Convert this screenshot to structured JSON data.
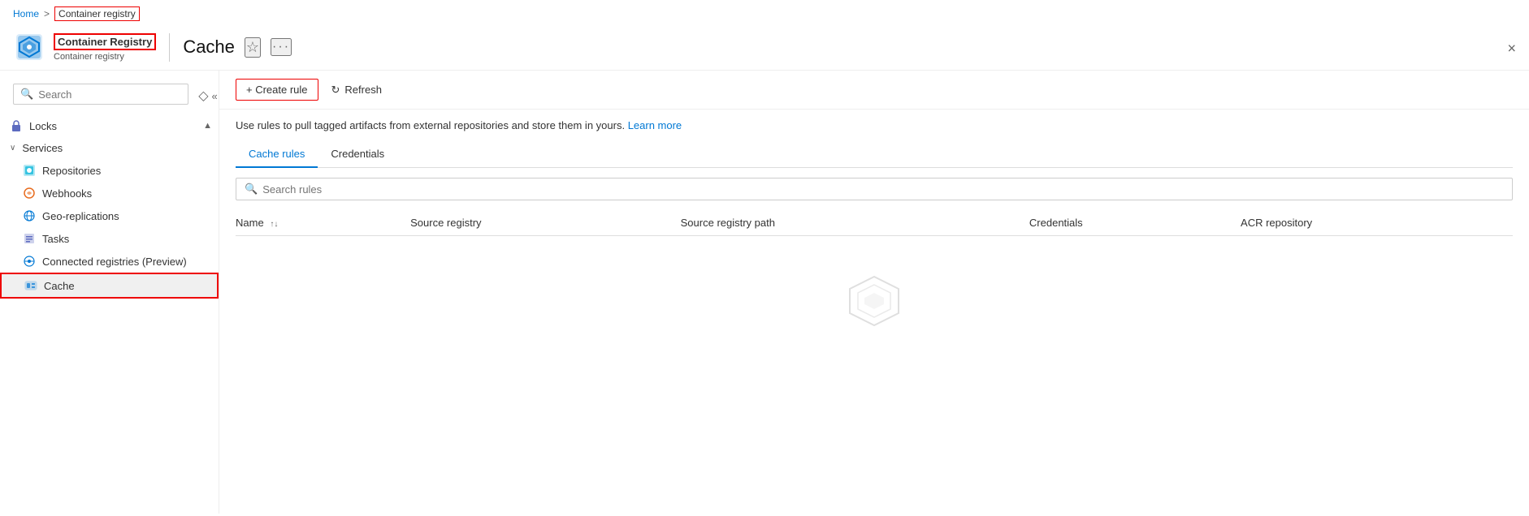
{
  "breadcrumb": {
    "home": "Home",
    "separator": ">",
    "current": "Container registry"
  },
  "header": {
    "service_name": "Container Registry",
    "sub_label": "Container registry",
    "resource_name": "Cache",
    "close_label": "×"
  },
  "sidebar": {
    "search_placeholder": "Search",
    "items_before": [
      {
        "id": "locks",
        "label": "Locks",
        "icon": "lock"
      }
    ],
    "services_group": "Services",
    "services_expanded": true,
    "service_items": [
      {
        "id": "repositories",
        "label": "Repositories",
        "icon": "repo"
      },
      {
        "id": "webhooks",
        "label": "Webhooks",
        "icon": "webhook"
      },
      {
        "id": "geo-replications",
        "label": "Geo-replications",
        "icon": "geo"
      },
      {
        "id": "tasks",
        "label": "Tasks",
        "icon": "task"
      },
      {
        "id": "connected-registries",
        "label": "Connected registries (Preview)",
        "icon": "connected"
      },
      {
        "id": "cache",
        "label": "Cache",
        "icon": "cache",
        "active": true
      }
    ]
  },
  "toolbar": {
    "create_rule_label": "+ Create rule",
    "refresh_label": "Refresh"
  },
  "content": {
    "description": "Use rules to pull tagged artifacts from external repositories and store them in yours.",
    "learn_more": "Learn more",
    "tabs": [
      {
        "id": "cache-rules",
        "label": "Cache rules",
        "active": true
      },
      {
        "id": "credentials",
        "label": "Credentials",
        "active": false
      }
    ],
    "search_rules_placeholder": "Search rules",
    "table_columns": [
      {
        "id": "name",
        "label": "Name",
        "sortable": true
      },
      {
        "id": "source-registry",
        "label": "Source registry",
        "sortable": false
      },
      {
        "id": "source-registry-path",
        "label": "Source registry path",
        "sortable": false
      },
      {
        "id": "credentials",
        "label": "Credentials",
        "sortable": false
      },
      {
        "id": "acr-repository",
        "label": "ACR repository",
        "sortable": false
      }
    ],
    "table_rows": []
  },
  "icons": {
    "search": "🔍",
    "star": "☆",
    "more": "···",
    "chevron_down": "∨",
    "up_arrow": "▲",
    "refresh": "↻",
    "sort": "↑↓",
    "collapse": "«"
  }
}
